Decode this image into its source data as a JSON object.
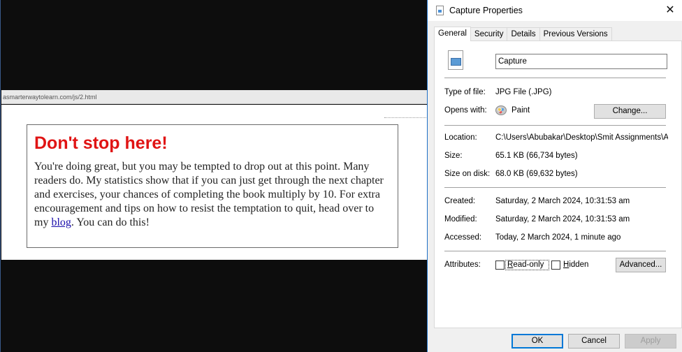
{
  "browser": {
    "url": "asmarterwaytolearn.com/js/2.html",
    "callout": {
      "title": "Don't stop here!",
      "body_before_link": "You're doing great, but you may be tempted to drop out at this point. Many readers do. My statistics show that if you can just get through the next chapter and exercises, your chances of completing the book multiply by 10. For extra encouragement and tips on how to resist the temptation to quit, head over to my ",
      "link_text": "blog",
      "body_after_link": ". You can do this!"
    }
  },
  "dialog": {
    "title": "Capture Properties",
    "close_icon": "close-icon",
    "tabs": [
      {
        "label": "General",
        "active": true
      },
      {
        "label": "Security",
        "active": false
      },
      {
        "label": "Details",
        "active": false
      },
      {
        "label": "Previous Versions",
        "active": false
      }
    ],
    "file_name": "Capture",
    "type_label": "Type of file:",
    "type_value": "JPG File (.JPG)",
    "opens_label": "Opens with:",
    "opens_value": "Paint",
    "change_button": "Change...",
    "location_label": "Location:",
    "location_value": "C:\\Users\\Abubakar\\Desktop\\Smit Assignments\\Ass",
    "size_label": "Size:",
    "size_value": "65.1 KB (66,734 bytes)",
    "size_on_disk_label": "Size on disk:",
    "size_on_disk_value": "68.0 KB (69,632 bytes)",
    "created_label": "Created:",
    "created_value": "Saturday, 2 March 2024, 10:31:53 am",
    "modified_label": "Modified:",
    "modified_value": "Saturday, 2 March 2024, 10:31:53 am",
    "accessed_label": "Accessed:",
    "accessed_value": "Today, 2 March 2024, 1 minute ago",
    "attributes_label": "Attributes:",
    "readonly_label": "Read-only",
    "readonly_checked": false,
    "hidden_label": "Hidden",
    "hidden_checked": false,
    "advanced_button": "Advanced...",
    "ok_button": "OK",
    "cancel_button": "Cancel",
    "apply_button": "Apply"
  }
}
